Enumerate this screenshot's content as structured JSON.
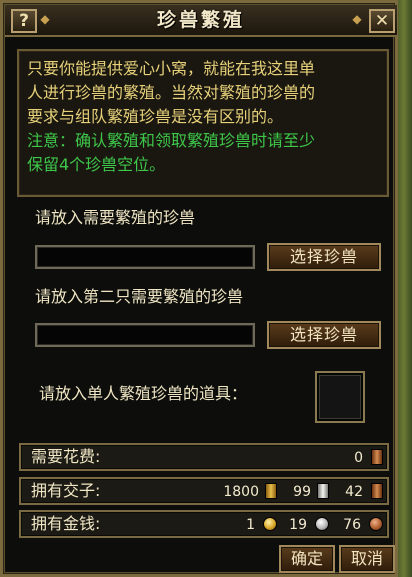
{
  "dialog": {
    "title": "珍兽繁殖",
    "help_glyph": "?",
    "close_glyph": "✕"
  },
  "info": {
    "description_line1": "只要你能提供爱心小窝，就能在我这里单",
    "description_line2": "人进行珍兽的繁殖。当然对繁殖的珍兽的",
    "description_line3": "要求与组队繁殖珍兽是没有区别的。",
    "note_line1": "注意：确认繁殖和领取繁殖珍兽时请至少",
    "note_line2": "保留4个珍兽空位。"
  },
  "slot1": {
    "label": "请放入需要繁殖的珍兽",
    "button": "选择珍兽",
    "value": ""
  },
  "slot2": {
    "label": "请放入第二只需要繁殖的珍兽",
    "button": "选择珍兽",
    "value": ""
  },
  "item": {
    "label": "请放入单人繁殖珍兽的道具："
  },
  "cost": {
    "label": "需要花费:",
    "value": "0"
  },
  "jiaozi": {
    "label": "拥有交子:",
    "gold": "1800",
    "silver": "99",
    "copper": "42"
  },
  "money": {
    "label": "拥有金钱:",
    "gold": "1",
    "silver": "19",
    "copper": "76"
  },
  "actions": {
    "confirm": "确定",
    "cancel": "取消"
  },
  "colors": {
    "description_text": "#e7d27a",
    "note_text": "#3ec84a",
    "label_text": "#f0e6c4",
    "frame_border": "#7a6a3e",
    "button_fill": "#4a3018"
  },
  "icons": {
    "help": "question-mark-icon",
    "close": "close-icon",
    "jiaozi": "ingot-icon",
    "money": "coin-icon"
  }
}
